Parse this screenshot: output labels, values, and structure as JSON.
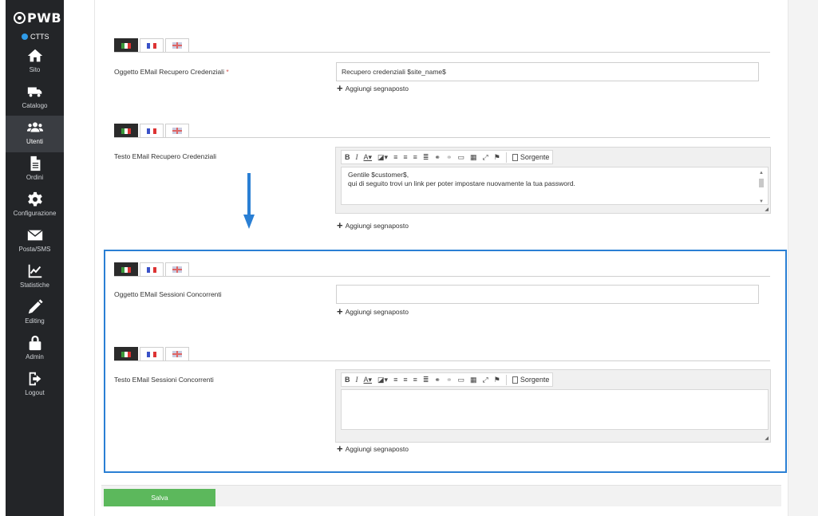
{
  "sidebar": {
    "logo": "PWB",
    "env": "CTTS",
    "items": [
      {
        "label": "Sito",
        "icon": "home-icon"
      },
      {
        "label": "Catalogo",
        "icon": "truck-icon"
      },
      {
        "label": "Utenti",
        "icon": "users-icon",
        "active": true
      },
      {
        "label": "Ordini",
        "icon": "document-icon"
      },
      {
        "label": "Configurazione",
        "icon": "gear-icon"
      },
      {
        "label": "Posta/SMS",
        "icon": "envelope-icon"
      },
      {
        "label": "Statistiche",
        "icon": "chart-icon"
      },
      {
        "label": "Editing",
        "icon": "pencil-icon"
      },
      {
        "label": "Admin",
        "icon": "lock-icon"
      },
      {
        "label": "Logout",
        "icon": "logout-icon"
      }
    ]
  },
  "fields": {
    "recovery_subject": {
      "label": "Oggetto EMail Recupero Credenziali",
      "required": "*",
      "value": "Recupero credenziali $site_name$",
      "add_placeholder": "Aggiungi segnaposto"
    },
    "recovery_body": {
      "label": "Testo EMail Recupero Credenziali",
      "line1": "Gentile $customer$,",
      "line2": "qui di seguito trovi un link per poter impostare nuovamente la tua password.",
      "add_placeholder": "Aggiungi segnaposto"
    },
    "sessions_subject": {
      "label": "Oggetto EMail Sessioni Concorrenti",
      "value": "",
      "add_placeholder": "Aggiungi segnaposto"
    },
    "sessions_body": {
      "label": "Testo EMail Sessioni Concorrenti",
      "add_placeholder": "Aggiungi segnaposto"
    }
  },
  "editor_toolbar": {
    "bold": "B",
    "italic": "I",
    "text_color": "A",
    "source": "Sorgente"
  },
  "actions": {
    "save": "Salva"
  },
  "colors": {
    "sidebar_bg": "#232528",
    "highlight_border": "#2a7fd4",
    "save_button": "#5cb85c",
    "env_dot": "#2f9be8"
  }
}
